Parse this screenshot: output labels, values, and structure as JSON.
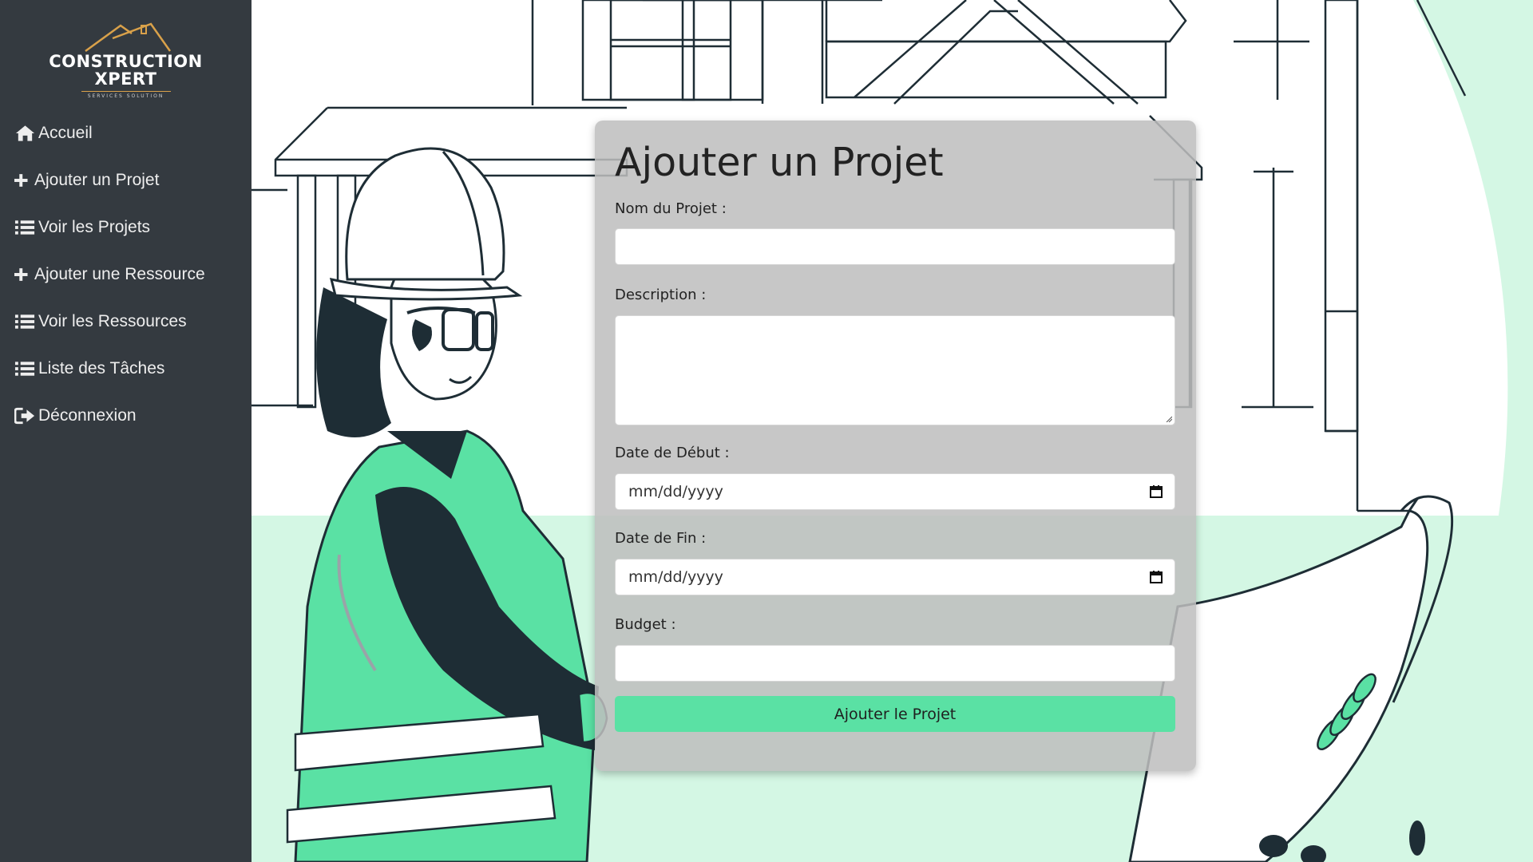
{
  "brand": {
    "line1": "CONSTRUCTION",
    "line2": "XPERT",
    "tagline": "SERVICES SOLUTION"
  },
  "sidebar": {
    "items": [
      {
        "label": "Accueil",
        "icon": "home-icon"
      },
      {
        "label": "Ajouter un Projet",
        "icon": "plus-icon"
      },
      {
        "label": "Voir les Projets",
        "icon": "list-icon"
      },
      {
        "label": "Ajouter une Ressource",
        "icon": "plus-icon"
      },
      {
        "label": "Voir les Ressources",
        "icon": "list-icon"
      },
      {
        "label": "Liste des Tâches",
        "icon": "list-icon"
      },
      {
        "label": "Déconnexion",
        "icon": "sign-out-icon"
      }
    ]
  },
  "form": {
    "title": "Ajouter un Projet",
    "name_label": "Nom du Projet :",
    "name_value": "",
    "description_label": "Description :",
    "description_value": "",
    "start_label": "Date de Début :",
    "start_placeholder": "mm/dd/yyyy",
    "end_label": "Date de Fin :",
    "end_placeholder": "mm/dd/yyyy",
    "budget_label": "Budget :",
    "budget_value": "",
    "submit_label": "Ajouter le Projet"
  },
  "colors": {
    "sidebar_bg": "#343a40",
    "accent_green": "#5ae1a4",
    "mint_bg": "#d4f7e4",
    "ink": "#1e2d35"
  }
}
